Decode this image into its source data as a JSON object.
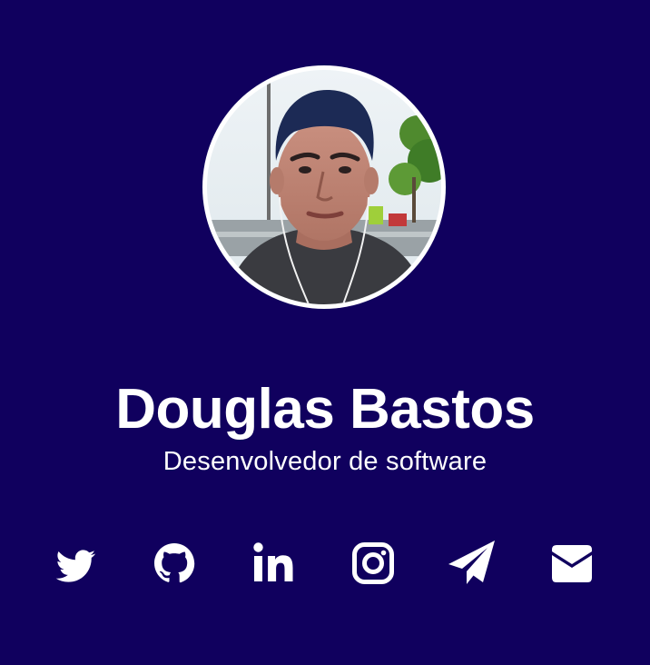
{
  "profile": {
    "name": "Douglas Bastos",
    "role": "Desenvolvedor de software",
    "avatar_alt": "profile-photo"
  },
  "social_links": [
    {
      "icon": "twitter-icon"
    },
    {
      "icon": "github-icon"
    },
    {
      "icon": "linkedin-icon"
    },
    {
      "icon": "instagram-icon"
    },
    {
      "icon": "telegram-icon"
    },
    {
      "icon": "email-icon"
    }
  ],
  "colors": {
    "background": "#10005e",
    "text": "#ffffff",
    "avatar_border": "#ffffff"
  }
}
